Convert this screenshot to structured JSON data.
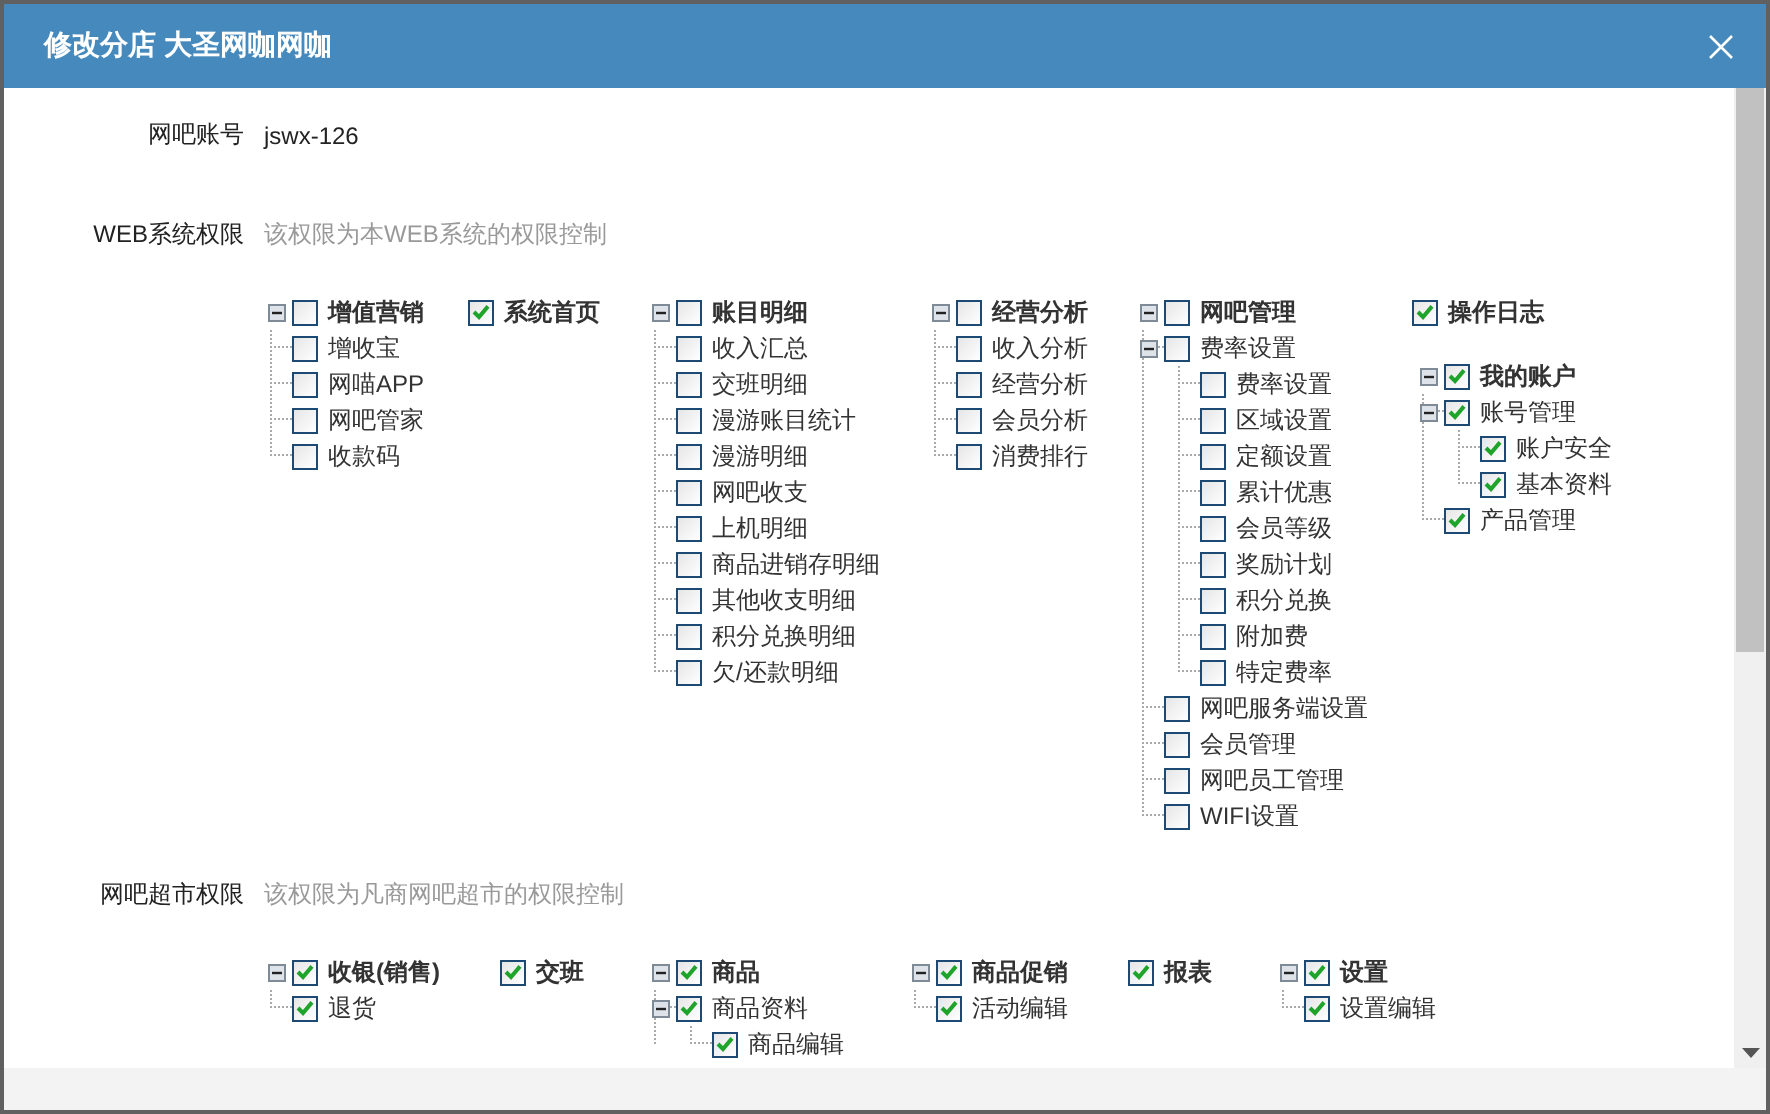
{
  "window": {
    "title": "修改分店 大圣网咖网咖"
  },
  "account": {
    "label": "网吧账号",
    "value": "jswx-126"
  },
  "sections": [
    {
      "label": "WEB系统权限",
      "hint": "该权限为本WEB系统的权限控制",
      "columns": [
        [
          {
            "label": "增值营销",
            "checked": false,
            "expanded": true,
            "children": [
              {
                "label": "增收宝",
                "checked": false
              },
              {
                "label": "网喵APP",
                "checked": false
              },
              {
                "label": "网吧管家",
                "checked": false
              },
              {
                "label": "收款码",
                "checked": false
              }
            ]
          }
        ],
        [
          {
            "label": "系统首页",
            "checked": true
          }
        ],
        [
          {
            "label": "账目明细",
            "checked": false,
            "expanded": true,
            "children": [
              {
                "label": "收入汇总",
                "checked": false
              },
              {
                "label": "交班明细",
                "checked": false
              },
              {
                "label": "漫游账目统计",
                "checked": false
              },
              {
                "label": "漫游明细",
                "checked": false
              },
              {
                "label": "网吧收支",
                "checked": false
              },
              {
                "label": "上机明细",
                "checked": false
              },
              {
                "label": "商品进销存明细",
                "checked": false
              },
              {
                "label": "其他收支明细",
                "checked": false
              },
              {
                "label": "积分兑换明细",
                "checked": false
              },
              {
                "label": "欠/还款明细",
                "checked": false
              }
            ]
          }
        ],
        [
          {
            "label": "经营分析",
            "checked": false,
            "expanded": true,
            "children": [
              {
                "label": "收入分析",
                "checked": false
              },
              {
                "label": "经营分析",
                "checked": false
              },
              {
                "label": "会员分析",
                "checked": false
              },
              {
                "label": "消费排行",
                "checked": false
              }
            ]
          }
        ],
        [
          {
            "label": "网吧管理",
            "checked": false,
            "expanded": true,
            "children": [
              {
                "label": "费率设置",
                "checked": false,
                "expanded": true,
                "children": [
                  {
                    "label": "费率设置",
                    "checked": false
                  },
                  {
                    "label": "区域设置",
                    "checked": false
                  },
                  {
                    "label": "定额设置",
                    "checked": false
                  },
                  {
                    "label": "累计优惠",
                    "checked": false
                  },
                  {
                    "label": "会员等级",
                    "checked": false
                  },
                  {
                    "label": "奖励计划",
                    "checked": false
                  },
                  {
                    "label": "积分兑换",
                    "checked": false
                  },
                  {
                    "label": "附加费",
                    "checked": false
                  },
                  {
                    "label": "特定费率",
                    "checked": false
                  }
                ]
              },
              {
                "label": "网吧服务端设置",
                "checked": false
              },
              {
                "label": "会员管理",
                "checked": false
              },
              {
                "label": "网吧员工管理",
                "checked": false
              },
              {
                "label": "WIFI设置",
                "checked": false
              }
            ]
          }
        ],
        [
          {
            "label": "操作日志",
            "checked": true
          },
          {
            "label": "我的账户",
            "checked": true,
            "expanded": true,
            "children": [
              {
                "label": "账号管理",
                "checked": true,
                "expanded": true,
                "children": [
                  {
                    "label": "账户安全",
                    "checked": true
                  },
                  {
                    "label": "基本资料",
                    "checked": true
                  }
                ]
              },
              {
                "label": "产品管理",
                "checked": true
              }
            ]
          }
        ]
      ]
    },
    {
      "label": "网吧超市权限",
      "hint": "该权限为凡商网吧超市的权限控制",
      "columns": [
        [
          {
            "label": "收银(销售)",
            "checked": true,
            "expanded": true,
            "children": [
              {
                "label": "退货",
                "checked": true
              }
            ]
          }
        ],
        [
          {
            "label": "交班",
            "checked": true
          }
        ],
        [
          {
            "label": "商品",
            "checked": true,
            "expanded": true,
            "children": [
              {
                "label": "商品资料",
                "checked": true,
                "expanded": true,
                "children": [
                  {
                    "label": "商品编辑",
                    "checked": true
                  }
                ]
              }
            ]
          }
        ],
        [
          {
            "label": "商品促销",
            "checked": true,
            "expanded": true,
            "children": [
              {
                "label": "活动编辑",
                "checked": true
              }
            ]
          }
        ],
        [
          {
            "label": "报表",
            "checked": true
          }
        ],
        [
          {
            "label": "设置",
            "checked": true,
            "expanded": true,
            "children": [
              {
                "label": "设置编辑",
                "checked": true
              }
            ]
          }
        ]
      ]
    }
  ]
}
